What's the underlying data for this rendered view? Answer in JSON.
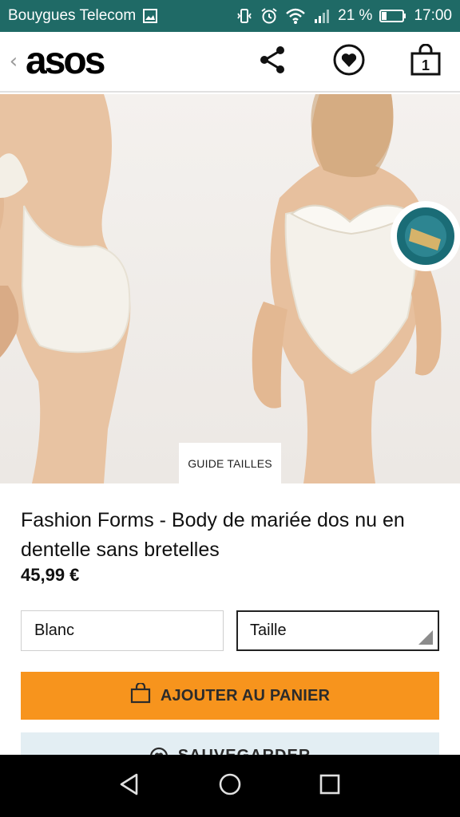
{
  "status_bar": {
    "carrier": "Bouygues Telecom",
    "battery": "21 %",
    "time": "17:00"
  },
  "header": {
    "logo": "asos",
    "bag_count": "1"
  },
  "product": {
    "size_guide": "GUIDE TAILLES",
    "title": "Fashion Forms - Body de mariée dos nu en dentelle sans bretelles",
    "price": "45,99 €",
    "colour": "Blanc",
    "size_placeholder": "Taille",
    "add_to_bag": "AJOUTER AU PANIER",
    "save": "SAUVEGARDER"
  },
  "colors": {
    "status_bar": "#1f6a66",
    "cta": "#f7941d",
    "save_bg": "#e3eef3"
  }
}
